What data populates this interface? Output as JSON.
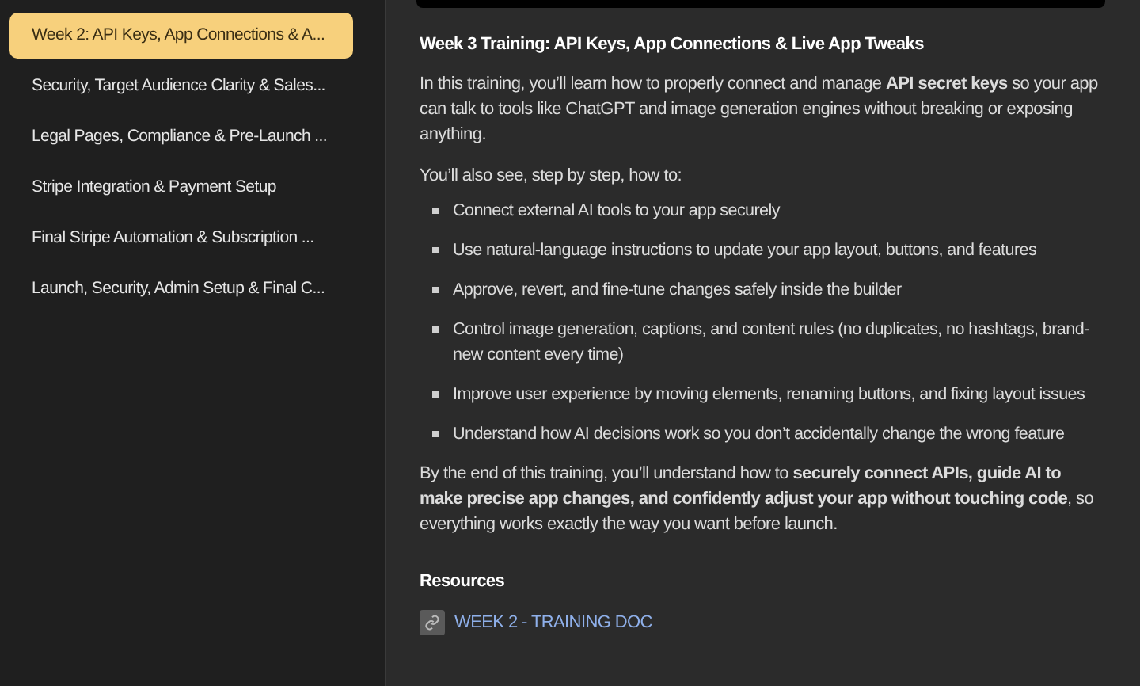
{
  "sidebar": {
    "items": [
      {
        "label": "Week 2: API Keys, App Connections & A...",
        "selected": true
      },
      {
        "label": "Security, Target Audience Clarity & Sales...",
        "selected": false
      },
      {
        "label": "Legal Pages, Compliance & Pre-Launch ...",
        "selected": false
      },
      {
        "label": "Stripe Integration & Payment Setup",
        "selected": false
      },
      {
        "label": "Final Stripe Automation & Subscription ...",
        "selected": false
      },
      {
        "label": "Launch, Security, Admin Setup & Final C...",
        "selected": false
      }
    ]
  },
  "lesson": {
    "title": "Week 3 Training: API Keys, App Connections & Live App Tweaks",
    "intro": "In this training, you’ll learn how to properly connect and manage **API secret keys** so your app can talk to tools like ChatGPT and image generation engines without breaking or exposing anything.",
    "lead": "You’ll also see, step by step, how to:",
    "bullets": [
      "Connect external AI tools to your app securely",
      "Use natural-language instructions to update your app layout, buttons, and features",
      "Approve, revert, and fine-tune changes safely inside the builder",
      "Control image generation, captions, and content rules (no duplicates, no hashtags, brand-new content every time)",
      "Improve user experience by moving elements, renaming buttons, and fixing layout issues",
      "Understand how AI decisions work so you don’t accidentally change the wrong feature"
    ],
    "outro": "By the end of this training, you’ll understand how to **securely connect APIs, guide AI to make precise app changes, and confidently adjust your app without touching code**, so everything works exactly the way you want before launch.",
    "resources_heading": "Resources",
    "resources": [
      {
        "label": "WEEK 2 - TRAINING DOC"
      }
    ]
  }
}
